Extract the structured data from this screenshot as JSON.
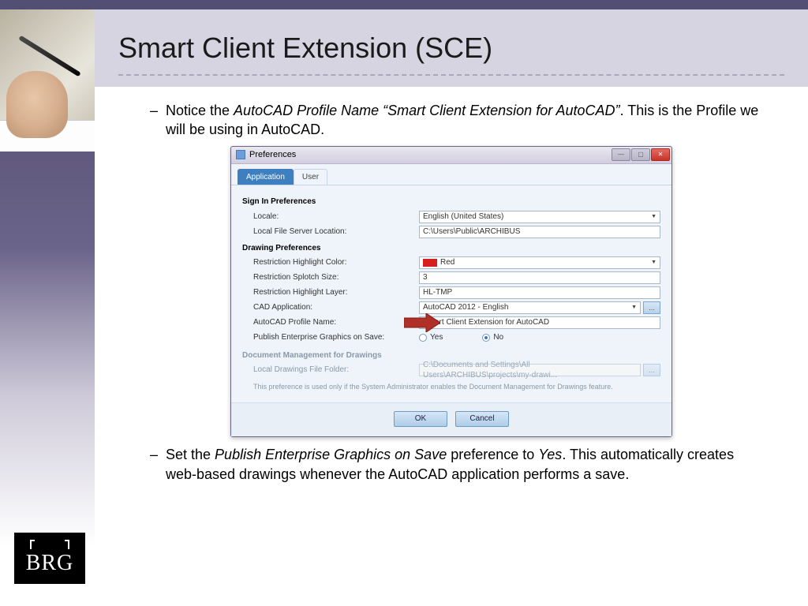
{
  "slide": {
    "title": "Smart Client Extension (SCE)",
    "bullet1_pre": "Notice the ",
    "bullet1_em": "AutoCAD Profile Name “Smart Client Extension for AutoCAD”",
    "bullet1_post": ".  This is the Profile we will be using in AutoCAD.",
    "bullet2_pre": "Set the ",
    "bullet2_em1": "Publish Enterprise Graphics on Save",
    "bullet2_mid": " preference to ",
    "bullet2_em2": "Yes",
    "bullet2_post": ".  This automatically creates web-based drawings whenever the AutoCAD application performs a save.",
    "logo_text": "BRG"
  },
  "dialog": {
    "title": "Preferences",
    "tabs": {
      "application": "Application",
      "user": "User"
    },
    "sign_in_head": "Sign In Preferences",
    "locale_label": "Locale:",
    "locale_value": "English (United States)",
    "lfs_label": "Local File Server Location:",
    "lfs_value": "C:\\Users\\Public\\ARCHIBUS",
    "drawing_head": "Drawing Preferences",
    "rhc_label": "Restriction Highlight Color:",
    "rhc_value": "Red",
    "rss_label": "Restriction Splotch Size:",
    "rss_value": "3",
    "rhl_label": "Restriction Highlight Layer:",
    "rhl_value": "HL-TMP",
    "cad_label": "CAD Application:",
    "cad_value": "AutoCAD 2012 - English",
    "profile_label": "AutoCAD Profile Name:",
    "profile_value": "Smart Client Extension for AutoCAD",
    "publish_label": "Publish Enterprise Graphics on Save:",
    "radio_yes": "Yes",
    "radio_no": "No",
    "docmgmt_head": "Document Management for Drawings",
    "ldf_label": "Local Drawings File Folder:",
    "ldf_value": "C:\\Documents and Settings\\All Users\\ARCHIBUS\\projects\\my-drawi...",
    "doc_note": "This preference is used only if the System Administrator enables the Document Management for Drawings feature.",
    "ok": "OK",
    "cancel": "Cancel",
    "browse": "..."
  }
}
